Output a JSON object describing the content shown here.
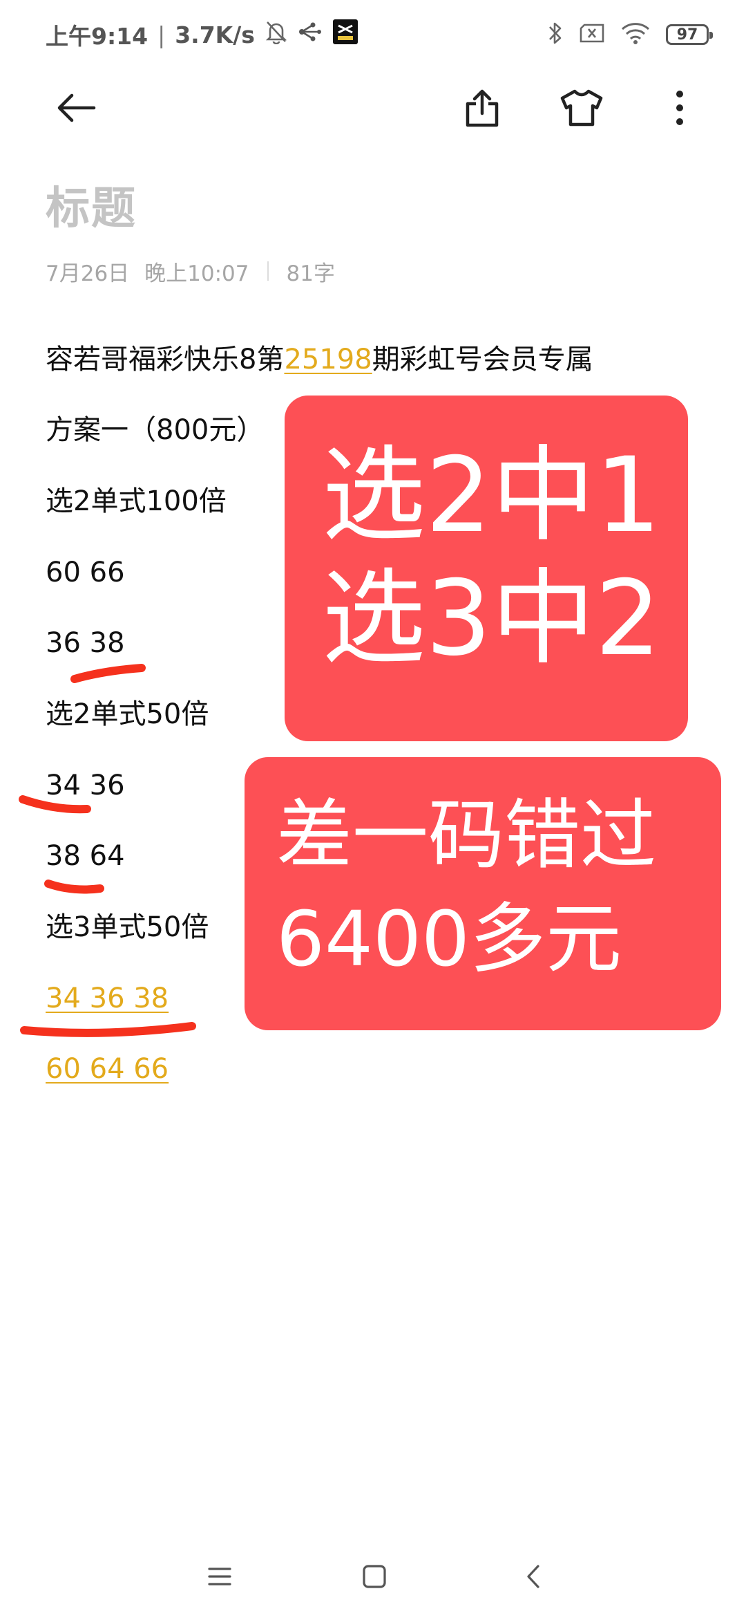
{
  "status_bar": {
    "time": "上午9:14",
    "network_speed": "3.7K/s",
    "battery_level": "97",
    "icons": [
      "mute-bell-icon",
      "share-network-icon",
      "capcut-app-icon",
      "bluetooth-icon",
      "sim-error-icon",
      "wifi-icon",
      "battery-icon"
    ]
  },
  "toolbar": {
    "icons": [
      "back-arrow-icon",
      "share-icon",
      "theme-shirt-icon",
      "more-vertical-icon"
    ]
  },
  "note": {
    "title_placeholder": "标题",
    "date": "7月26日",
    "time": "晚上10:07",
    "char_count": "81字",
    "lines": [
      {
        "pre": "容若哥福彩快乐8第",
        "link": "25198",
        "post": "期彩虹号会员专属"
      },
      {
        "text": "方案一（800元）"
      },
      {
        "text": "选2单式100倍"
      },
      {
        "text": "60 66"
      },
      {
        "text": "36 38"
      },
      {
        "text": "选2单式50倍"
      },
      {
        "text": "34 36"
      },
      {
        "text": "38 64"
      },
      {
        "text": "选3单式50倍"
      },
      {
        "link": "34 36 38"
      },
      {
        "link": "60 64 66"
      }
    ]
  },
  "overlays": {
    "card1": {
      "line1": "选2中1",
      "line2": "选3中2"
    },
    "card2": {
      "line1": "差一码错过",
      "line2": "6400多元"
    }
  },
  "colors": {
    "link": "#e3aa1c",
    "card": "#fd5055",
    "stroke": "#f5311d"
  },
  "nav_bar": {
    "icons": [
      "menu-icon",
      "home-square-icon",
      "back-chevron-icon"
    ]
  }
}
